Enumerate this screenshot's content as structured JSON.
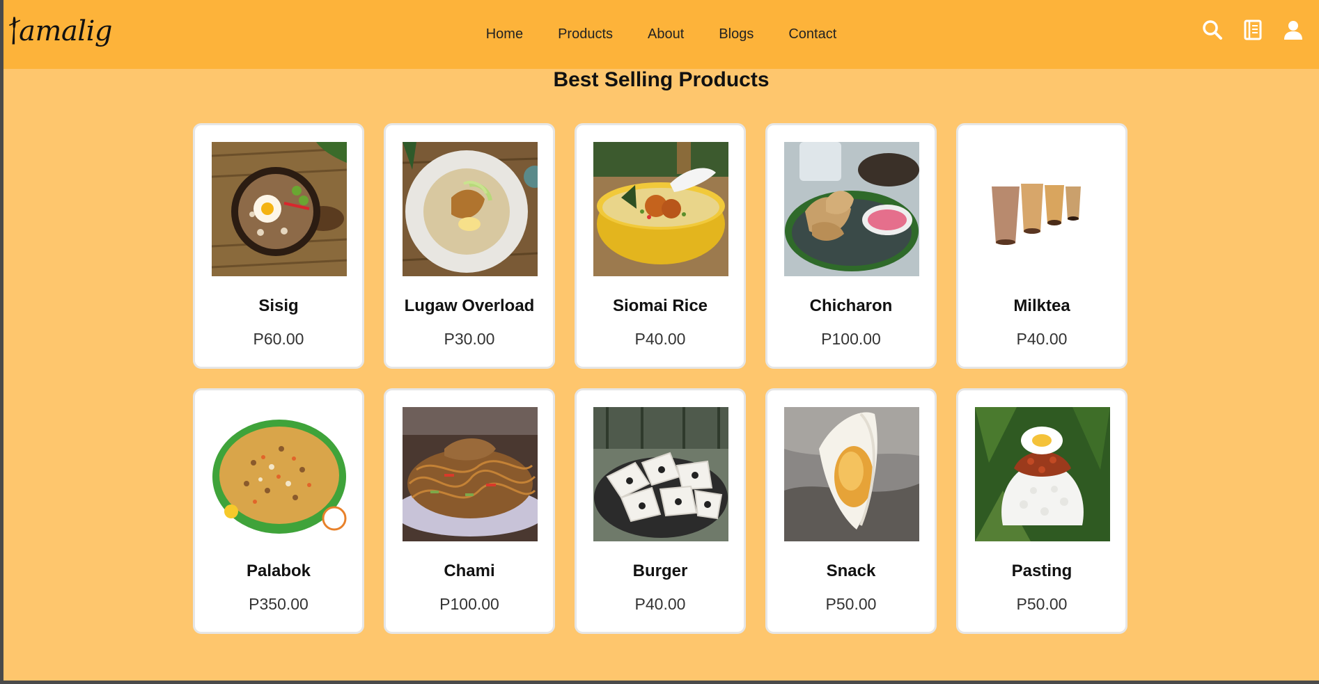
{
  "brand": {
    "logo_text": "amalig"
  },
  "nav": {
    "links": [
      {
        "label": "Home"
      },
      {
        "label": "Products"
      },
      {
        "label": "About"
      },
      {
        "label": "Blogs"
      },
      {
        "label": "Contact"
      }
    ],
    "icons": [
      "search-icon",
      "notebook-icon",
      "user-icon"
    ]
  },
  "section": {
    "title": "Best Selling Products"
  },
  "products": [
    {
      "name": "Sisig",
      "price": "P60.00",
      "image": "sisig-image"
    },
    {
      "name": "Lugaw Overload",
      "price": "P30.00",
      "image": "lugaw-image"
    },
    {
      "name": "Siomai Rice",
      "price": "P40.00",
      "image": "siomai-rice-image"
    },
    {
      "name": "Chicharon",
      "price": "P100.00",
      "image": "chicharon-image"
    },
    {
      "name": "Milktea",
      "price": "P40.00",
      "image": "milktea-image"
    },
    {
      "name": "Palabok",
      "price": "P350.00",
      "image": "palabok-image"
    },
    {
      "name": "Chami",
      "price": "P100.00",
      "image": "chami-image"
    },
    {
      "name": "Burger",
      "price": "P40.00",
      "image": "burger-image"
    },
    {
      "name": "Snack",
      "price": "P50.00",
      "image": "snack-image"
    },
    {
      "name": "Pasting",
      "price": "P50.00",
      "image": "pasting-image"
    }
  ],
  "colors": {
    "navbar": "#fdb33a",
    "background": "#fec66d",
    "card": "#ffffff"
  }
}
